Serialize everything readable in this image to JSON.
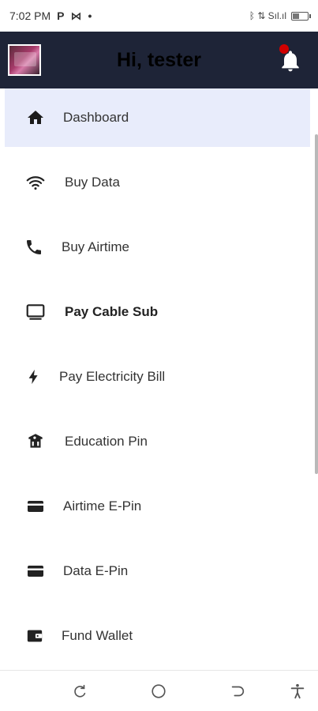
{
  "status_bar": {
    "time": "7:02 PM",
    "glyphs": [
      "P",
      "⋈",
      "•"
    ],
    "right_text": "ᛒ ⇅ Sıl.ıl"
  },
  "header": {
    "greeting": "Hi, tester",
    "bg_color": "#1e2437",
    "notification_dot_color": "#d10000"
  },
  "menu": {
    "items": [
      {
        "label": "Dashboard",
        "icon": "home-icon",
        "active": true
      },
      {
        "label": "Buy Data",
        "icon": "wifi-icon"
      },
      {
        "label": "Buy Airtime",
        "icon": "phone-icon"
      },
      {
        "label": "Pay Cable Sub",
        "icon": "tv-icon"
      },
      {
        "label": "Pay Electricity Bill",
        "icon": "bolt-icon"
      },
      {
        "label": "Education Pin",
        "icon": "school-icon"
      },
      {
        "label": "Airtime E-Pin",
        "icon": "card-icon"
      },
      {
        "label": "Data E-Pin",
        "icon": "card-icon"
      },
      {
        "label": "Fund Wallet",
        "icon": "wallet-icon"
      }
    ],
    "active_bg": "#e8ecfb"
  },
  "nav_bar": {
    "buttons": [
      "recents-icon",
      "home-circle-icon",
      "back-icon",
      "accessibility-icon"
    ]
  }
}
